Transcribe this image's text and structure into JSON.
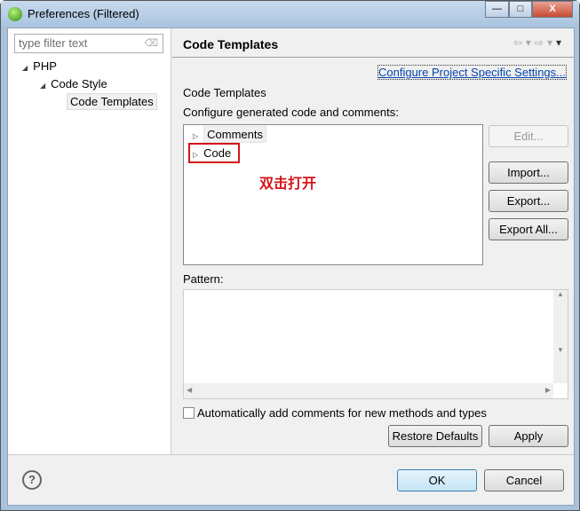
{
  "window": {
    "title": "Preferences (Filtered)",
    "minimize": "—",
    "maximize": "□",
    "close": "X"
  },
  "sidebar": {
    "filter_placeholder": "type filter text",
    "tree": [
      {
        "label": "PHP"
      },
      {
        "label": "Code Style"
      },
      {
        "label": "Code Templates"
      }
    ]
  },
  "page": {
    "title": "Code Templates",
    "link": "Configure Project Specific Settings...",
    "section_label": "Code Templates",
    "description": "Configure generated code and comments:",
    "templates": [
      {
        "label": "Comments"
      },
      {
        "label": "Code"
      }
    ],
    "annotation": "双击打开",
    "annotation_color": "#d4141b",
    "buttons": {
      "edit": "Edit...",
      "import": "Import...",
      "export": "Export...",
      "export_all": "Export All..."
    },
    "pattern_label": "Pattern:",
    "auto_comments": "Automatically add comments for new methods and types",
    "auto_comments_checked": false,
    "restore_defaults": "Restore Defaults",
    "apply": "Apply"
  },
  "footer": {
    "help": "?",
    "ok": "OK",
    "cancel": "Cancel"
  }
}
